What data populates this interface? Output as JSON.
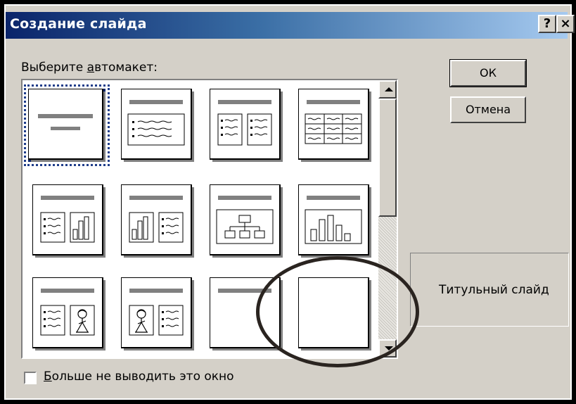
{
  "window": {
    "title": "Создание слайда",
    "help_button": "?",
    "close_button": "×"
  },
  "prompt": {
    "before": "Выберите ",
    "accel": "а",
    "after": "втомакет:"
  },
  "buttons": {
    "ok": "ОК",
    "cancel": "Отмена"
  },
  "preview": {
    "label": "Титульный слайд"
  },
  "checkbox": {
    "accel": "Б",
    "after": "ольше не выводить это окно",
    "checked": false
  },
  "layouts": [
    {
      "id": "title",
      "selected": true
    },
    {
      "id": "bulleted-list"
    },
    {
      "id": "two-column-text"
    },
    {
      "id": "table"
    },
    {
      "id": "text-and-chart"
    },
    {
      "id": "chart-and-text"
    },
    {
      "id": "organization-chart"
    },
    {
      "id": "chart"
    },
    {
      "id": "text-and-clip-art"
    },
    {
      "id": "clip-art-and-text"
    },
    {
      "id": "title-only"
    },
    {
      "id": "blank"
    }
  ],
  "colors": {
    "title_bar_start": "#0a246a",
    "title_bar_end": "#a6caf0",
    "face": "#d4d0c8",
    "annotation_circle": "#2a2420"
  }
}
